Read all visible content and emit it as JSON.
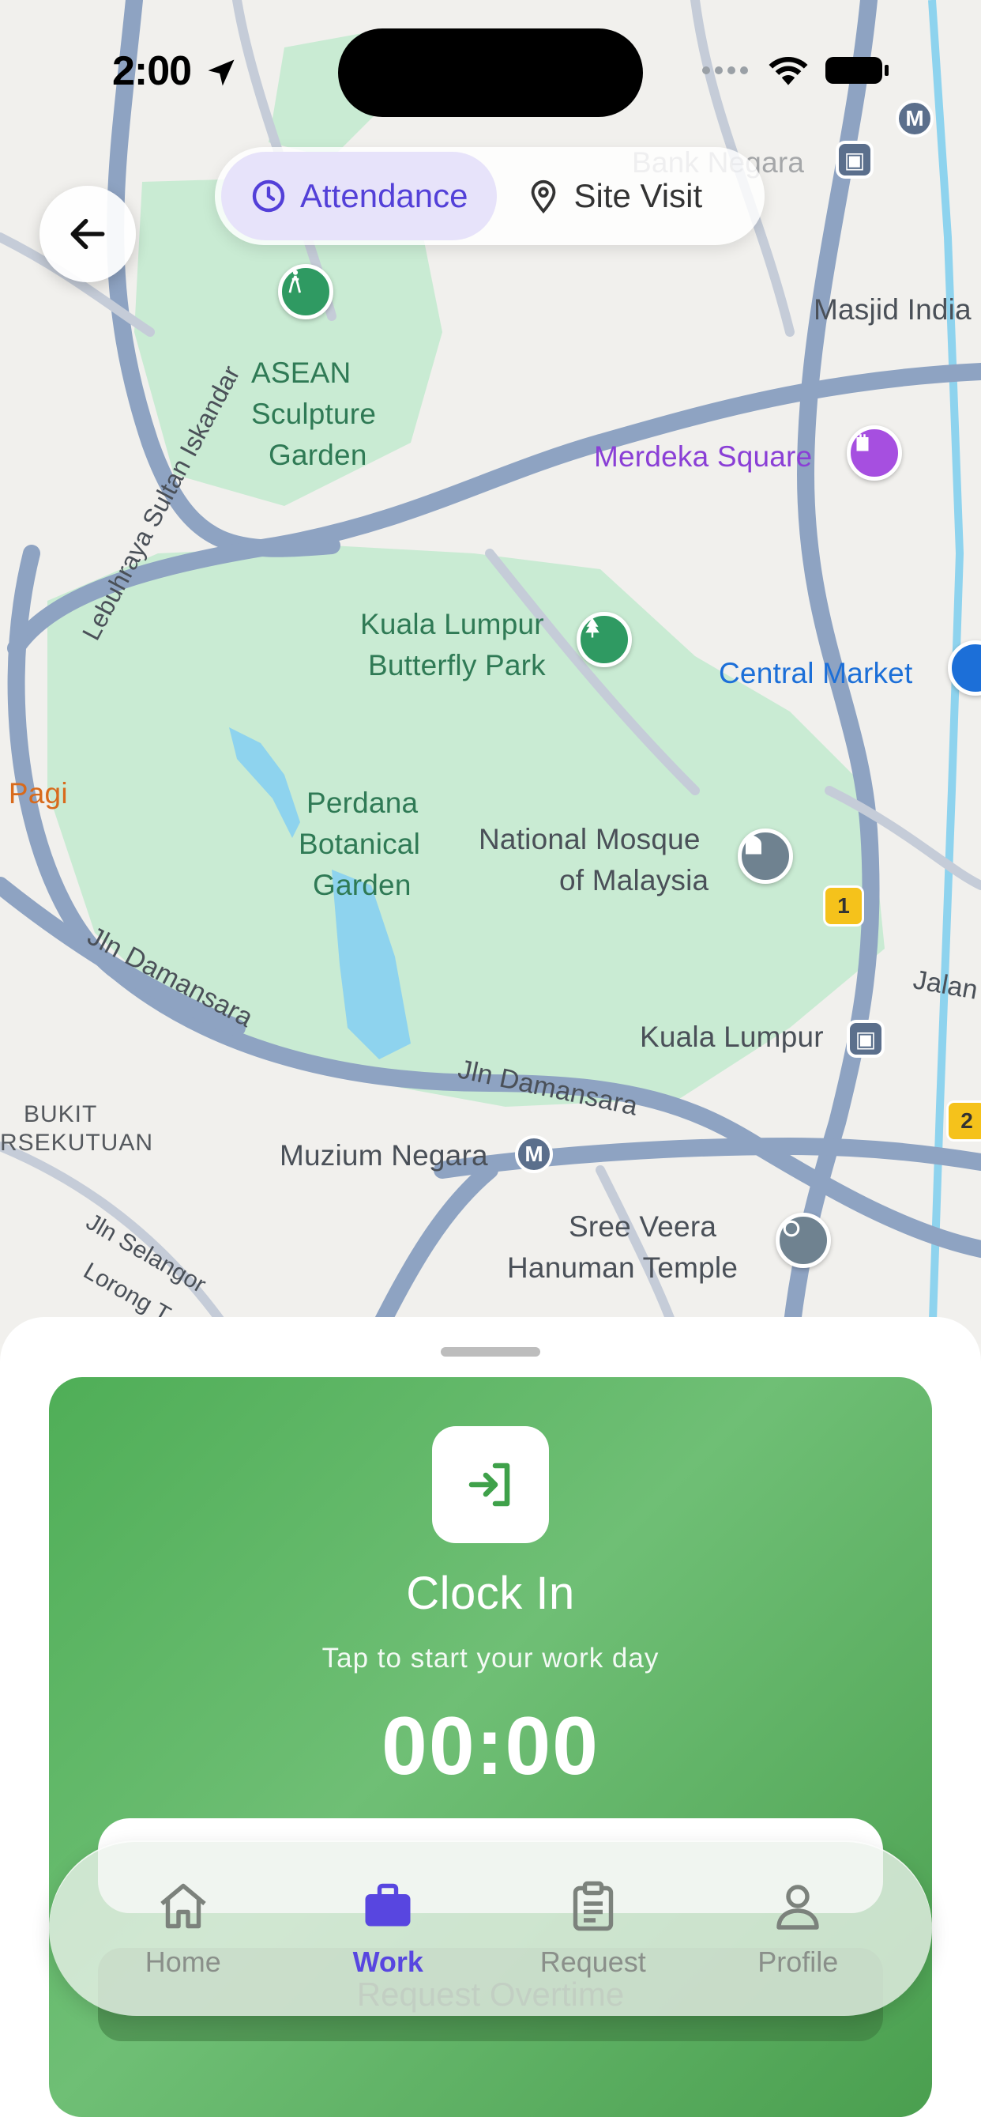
{
  "status_bar": {
    "time": "2:00"
  },
  "header": {
    "back_icon": "arrow-left-icon",
    "tabs": [
      {
        "label": "Attendance",
        "icon": "clock-icon",
        "active": true
      },
      {
        "label": "Site Visit",
        "icon": "location-pin-icon",
        "active": false
      }
    ]
  },
  "map": {
    "labels": {
      "bank_negara": "Bank Negara",
      "masjid_india": "Masjid India",
      "asean_1": "ASEAN",
      "asean_2": "Sculpture",
      "asean_3": "Garden",
      "merdeka": "Merdeka Square",
      "butterfly_1": "Kuala Lumpur",
      "butterfly_2": "Butterfly Park",
      "central_market": "Central Market",
      "botanical_1": "Perdana",
      "botanical_2": "Botanical",
      "botanical_3": "Garden",
      "mosque_1": "National Mosque",
      "mosque_2": "of Malaysia",
      "kl": "Kuala Lumpur",
      "muzium": "Muzium Negara",
      "sree_1": "Sree Veera",
      "sree_2": "Hanuman Temple",
      "bukit_1": "BUKIT",
      "bukit_2": "RSEKUTUAN",
      "road_damansara_1": "Jln Damansara",
      "road_damansara_2": "Jln Damansara",
      "road_lebuhraya": "Lebuhraya Sultan Iskandar",
      "road_selangor": "Jln Selangor",
      "road_lorong": "Lorong T",
      "road_jalan": "Jalan",
      "pagi": "i Pagi",
      "route_1": "1",
      "route_2": "2",
      "metro_m": "M"
    }
  },
  "clock_card": {
    "icon": "login-arrow-icon",
    "title": "Clock In",
    "subtitle": "Tap to start your work day",
    "timer": "00:00",
    "secondary_button": "Request Overtime"
  },
  "tabbar": {
    "items": [
      {
        "label": "Home",
        "icon": "home-icon",
        "active": false
      },
      {
        "label": "Work",
        "icon": "briefcase-icon",
        "active": true
      },
      {
        "label": "Request",
        "icon": "clipboard-icon",
        "active": false
      },
      {
        "label": "Profile",
        "icon": "person-icon",
        "active": false
      }
    ]
  },
  "colors": {
    "accent": "#5846e0",
    "card_green": "#5cb462",
    "park_green": "#c8ecd3"
  }
}
